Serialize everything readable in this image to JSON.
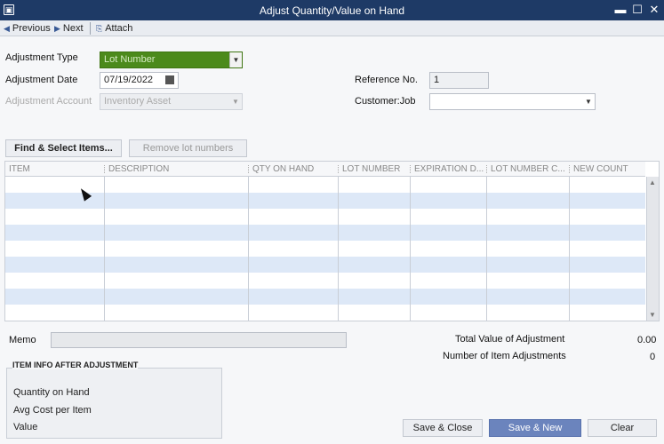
{
  "window": {
    "title": "Adjust Quantity/Value on Hand",
    "system_icon": "▣",
    "minimize": "▬",
    "maximize": "☐",
    "close": "✕"
  },
  "toolbar": {
    "previous": "Previous",
    "next": "Next",
    "attach": "Attach"
  },
  "form": {
    "adjustment_type_label": "Adjustment Type",
    "adjustment_type_value": "Lot Number",
    "adjustment_date_label": "Adjustment Date",
    "adjustment_date_value": "07/19/2022",
    "adjustment_account_label": "Adjustment Account",
    "adjustment_account_value": "Inventory Asset",
    "reference_no_label": "Reference No.",
    "reference_no_value": "1",
    "customer_job_label": "Customer:Job",
    "customer_job_value": ""
  },
  "actions": {
    "find_select_items": "Find & Select Items...",
    "remove_lot_numbers": "Remove lot numbers"
  },
  "grid": {
    "columns": [
      "ITEM",
      "DESCRIPTION",
      "QTY ON HAND",
      "LOT NUMBER",
      "EXPIRATION D...",
      "LOT NUMBER C...",
      "NEW COUNT"
    ],
    "rows": 9
  },
  "memo": {
    "label": "Memo",
    "value": ""
  },
  "totals": {
    "total_value_label": "Total Value of Adjustment",
    "total_value": "0.00",
    "num_adjustments_label": "Number of Item Adjustments",
    "num_adjustments": "0"
  },
  "item_info": {
    "title": "ITEM INFO AFTER ADJUSTMENT",
    "quantity_on_hand": "Quantity on Hand",
    "avg_cost": "Avg Cost per Item",
    "value": "Value"
  },
  "footer": {
    "save_close": "Save & Close",
    "save_new": "Save & New",
    "clear": "Clear"
  },
  "colors": {
    "titlebar": "#1e3a66",
    "adjustment_type_highlight": "#4c8a1b",
    "grid_alt_row": "#dde8f7",
    "primary_button": "#6b84bd"
  }
}
